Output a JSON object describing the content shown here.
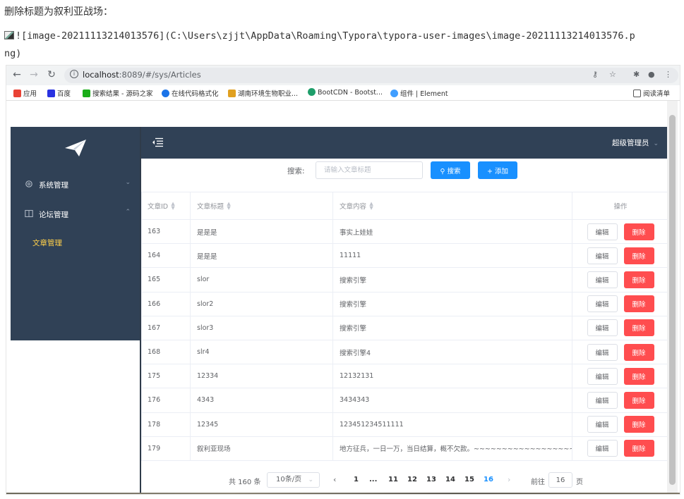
{
  "doc": {
    "heading": "删除标题为叙利亚战场：",
    "image_markdown_line1": "![image-20211113214013576](C:\\Users\\zjjt\\AppData\\Roaming\\Typora\\typora-user-images\\image-20211113214013576.p",
    "image_markdown_line2": "ng)"
  },
  "browser": {
    "url_host": "localhost",
    "url_rest": ":8089/#/sys/Articles",
    "bookmarks": [
      {
        "label": "应用",
        "color": "#e94235"
      },
      {
        "label": "百度",
        "color": "#2932e1"
      },
      {
        "label": "搜索结果 - 源码之家",
        "color": "#1aad19"
      },
      {
        "label": "在线代码格式化",
        "color": "#1a73e8"
      },
      {
        "label": "湖南环境生物职业...",
        "color": "#e0a020"
      },
      {
        "label": "BootCDN - Bootst...",
        "color": "#1e9e6a"
      },
      {
        "label": "组件 | Element",
        "color": "#409eff"
      }
    ],
    "reading_list": "阅读清单"
  },
  "sidebar": {
    "menus": [
      {
        "label": "系统管理",
        "arrow": "⌄"
      },
      {
        "label": "论坛管理",
        "arrow": "⌃"
      }
    ],
    "sub_item": "文章管理"
  },
  "header": {
    "user": "超级管理员"
  },
  "search": {
    "label": "搜索:",
    "placeholder": "请输入文章标题",
    "search_btn": "搜索",
    "add_btn": "添加"
  },
  "table": {
    "columns": [
      "文章ID",
      "文章标题",
      "文章内容",
      "操作"
    ],
    "edit_label": "编辑",
    "delete_label": "删除",
    "rows": [
      {
        "id": "163",
        "title": "是是是",
        "content": "事实上娃娃"
      },
      {
        "id": "164",
        "title": "是是是",
        "content": "11111"
      },
      {
        "id": "165",
        "title": "slor",
        "content": "搜索引擎"
      },
      {
        "id": "166",
        "title": "slor2",
        "content": "搜索引擎"
      },
      {
        "id": "167",
        "title": "slor3",
        "content": "搜索引擎"
      },
      {
        "id": "168",
        "title": "slr4",
        "content": "搜索引擎4"
      },
      {
        "id": "175",
        "title": "12334",
        "content": "12132131"
      },
      {
        "id": "176",
        "title": "4343",
        "content": "3434343"
      },
      {
        "id": "178",
        "title": "12345",
        "content": "123451234511111"
      },
      {
        "id": "179",
        "title": "叙利亚现场",
        "content": "地方征兵，一日一万，当日结算，概不欠款。~~~~~~~~~~~~~~~~~~~~~"
      }
    ]
  },
  "pagination": {
    "total": "共 160 条",
    "page_size": "10条/页",
    "pages": [
      "1",
      "...",
      "11",
      "12",
      "13",
      "14",
      "15",
      "16"
    ],
    "current": "16",
    "jump_prefix": "前往",
    "jump_value": "16",
    "jump_suffix": "页"
  },
  "colors": {
    "sidebar_bg": "#304156",
    "accent": "#1890ff",
    "danger": "#ff4d4f",
    "active_menu": "#ffd04b"
  }
}
